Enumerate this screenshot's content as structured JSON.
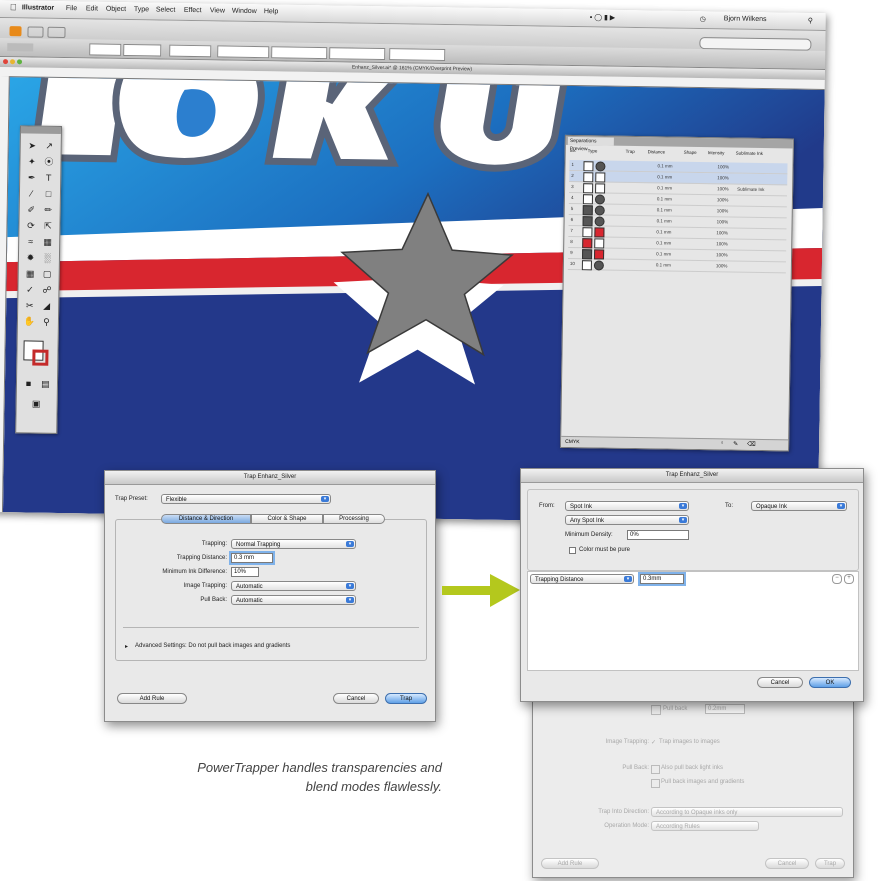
{
  "menubar": {
    "apple": "",
    "items": [
      "Illustrator",
      "File",
      "Edit",
      "Object",
      "Type",
      "Select",
      "Effect",
      "View",
      "Window",
      "Help"
    ],
    "user": "Bjorn Wilkens"
  },
  "document": {
    "title": "Enhanz_Silver.ai* @ 161% (CMYK/Overprint Preview)"
  },
  "canvas": {
    "heading_text": "OKUT",
    "colors": {
      "dark_blue": "#233a86",
      "light_blue": "#1e8fd6",
      "red": "#d8262f",
      "white": "#ffffff",
      "star": "#808080"
    }
  },
  "separations_panel": {
    "tab": "Separations Preview",
    "columns": [
      "Ink",
      "Type",
      "Trap",
      "Distance",
      "Shape",
      "Intensity",
      "Sublimate Ink"
    ],
    "rows": [
      {
        "ink": "1",
        "type": "",
        "distance": "0.1 mm",
        "intensity": "100%",
        "note": ""
      },
      {
        "ink": "2",
        "type": "",
        "distance": "0.1 mm",
        "intensity": "100%",
        "note": ""
      },
      {
        "ink": "3",
        "type": "",
        "distance": "0.1 mm",
        "intensity": "100%",
        "note": "Sublimate Ink"
      },
      {
        "ink": "4",
        "type": "",
        "distance": "0.1 mm",
        "intensity": "100%",
        "note": ""
      },
      {
        "ink": "5",
        "type": "",
        "distance": "0.1 mm",
        "intensity": "100%",
        "note": ""
      },
      {
        "ink": "6",
        "type": "",
        "distance": "0.1 mm",
        "intensity": "100%",
        "note": ""
      },
      {
        "ink": "7",
        "type": "",
        "distance": "0.1 mm",
        "intensity": "100%",
        "note": ""
      },
      {
        "ink": "8",
        "type": "",
        "distance": "0.1 mm",
        "intensity": "100%",
        "note": ""
      },
      {
        "ink": "9",
        "type": "",
        "distance": "0.1 mm",
        "intensity": "100%",
        "note": ""
      },
      {
        "ink": "10",
        "type": "",
        "distance": "0.1 mm",
        "intensity": "100%",
        "note": ""
      }
    ],
    "swatch_colors": [
      "#ffffff",
      "#ffffff",
      "#ffffff",
      "#ffffff",
      "#555555",
      "#555555",
      "#d8262f",
      "#ffffff",
      "#d8262f",
      "#555555"
    ],
    "footer": "CMYK"
  },
  "trap_dialog_1": {
    "title": "Trap Enhanz_Silver",
    "trap_preset_label": "Trap Preset:",
    "trap_preset_value": "Flexible",
    "tabs": [
      "Distance & Direction",
      "Color & Shape",
      "Processing"
    ],
    "trapping_label": "Trapping:",
    "trapping_value": "Normal Trapping",
    "distance_label": "Trapping Distance:",
    "distance_value": "0.3 mm",
    "min_ink_label": "Minimum Ink Difference:",
    "min_ink_value": "10%",
    "image_trapping_label": "Image Trapping:",
    "image_trapping_value": "Automatic",
    "pull_back_label": "Pull Back:",
    "pull_back_value": "Automatic",
    "advanced": "Advanced Settings: Do not pull back images and gradients",
    "add_rule": "Add Rule",
    "cancel": "Cancel",
    "trap": "Trap"
  },
  "trap_dialog_2": {
    "title": "Trap Enhanz_Silver",
    "from_label": "From:",
    "from_value": "Spot Ink",
    "to_label": "To:",
    "to_value": "Opaque Ink",
    "any_spot": "Any Spot Ink",
    "min_density_label": "Minimum Density:",
    "min_density_value": "0%",
    "color_pure": "Color must be pure",
    "rule_prop": "Trapping Distance",
    "rule_value": "0.3mm",
    "cancel": "Cancel",
    "ok": "OK"
  },
  "trap_dialog_2_lower": {
    "pull_back": "Pull back",
    "pull_back_value": "0.2mm",
    "image_trapping_label": "Image Trapping:",
    "image_trapping_check": "Trap images to images",
    "pull_back_label": "Pull Back:",
    "pull_back_opt1": "Also pull back light inks",
    "pull_back_opt2": "Pull back images and gradients",
    "trap_into_label": "Trap Into Direction:",
    "trap_into_value": "According to Opaque inks only",
    "operation_label": "Operation Mode:",
    "operation_value": "According Rules",
    "add_rule": "Add Rule",
    "cancel": "Cancel",
    "trap": "Trap"
  },
  "arrow_color": "#b4c81d",
  "caption": "PowerTrapper handles transparencies and blend modes flawlessly."
}
